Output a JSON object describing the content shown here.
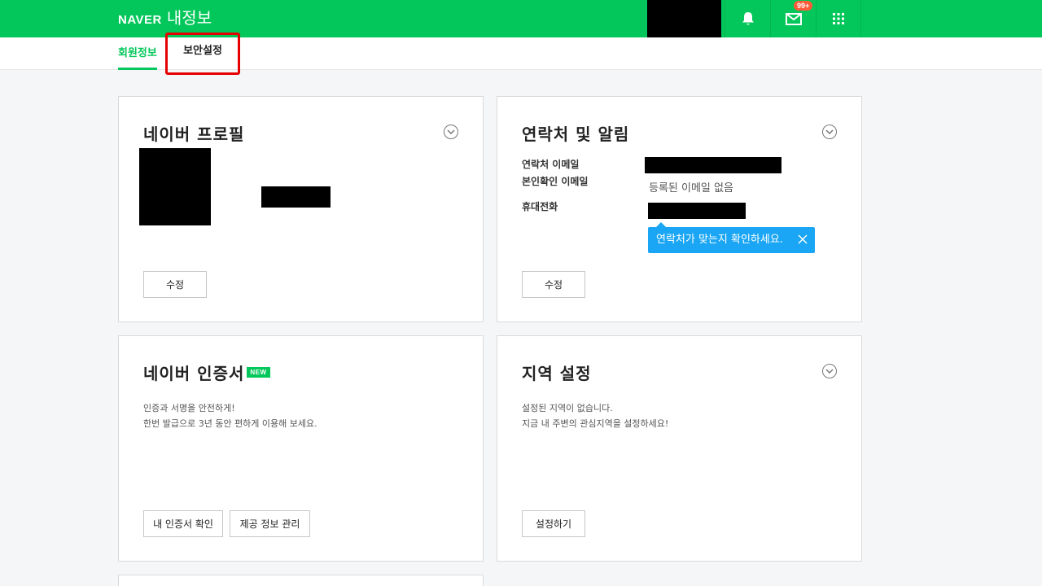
{
  "header": {
    "logo": "NAVER",
    "title": "내정보",
    "mail_badge": "99+",
    "icons": {
      "bell": "bell-icon",
      "mail": "mail-icon",
      "apps": "apps-grid-icon"
    },
    "accent_color": "#03c75a"
  },
  "tabs": [
    {
      "label": "회원정보",
      "active": true
    },
    {
      "label": "보안설정",
      "active": false,
      "highlighted": true,
      "highlight_color": "#e50000"
    }
  ],
  "cards": {
    "profile": {
      "title": "네이버 프로필",
      "edit_label": "수정"
    },
    "contact": {
      "title": "연락처 및 알림",
      "rows": [
        {
          "label": "연락처 이메일"
        },
        {
          "label": "본인확인 이메일",
          "value": "등록된 이메일 없음"
        },
        {
          "label": "휴대전화"
        }
      ],
      "tooltip": "연락처가 맞는지 확인하세요.",
      "tooltip_color": "#1aa6f5",
      "edit_label": "수정"
    },
    "certificate": {
      "title": "네이버 인증서",
      "badge": "NEW",
      "desc_line1": "인증과 서명을 안전하게!",
      "desc_line2": "한번 발급으로 3년 동안 편하게 이용해 보세요.",
      "btn_check": "내 인증서 확인",
      "btn_manage": "제공 정보 관리"
    },
    "region": {
      "title": "지역 설정",
      "desc_line1": "설정된 지역이 없습니다.",
      "desc_line2": "지금 내 주변의 관심지역을 설정하세요!",
      "btn_set": "설정하기"
    }
  }
}
